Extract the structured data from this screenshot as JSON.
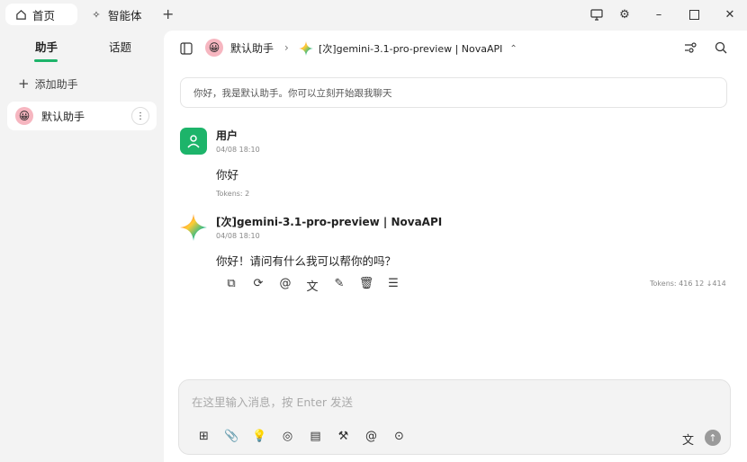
{
  "tabs": [
    {
      "label": "首页",
      "icon": "home-icon"
    },
    {
      "label": "智能体",
      "icon": "sparkle-icon"
    }
  ],
  "sidebar": {
    "tabs": [
      "助手",
      "话题"
    ],
    "add_label": "添加助手",
    "items": [
      {
        "label": "默认助手",
        "avatar": "😀"
      }
    ]
  },
  "header": {
    "assistant": "默认助手",
    "model": "[次]gemini-3.1-pro-preview | NovaAPI"
  },
  "notice": "你好，我是默认助手。你可以立刻开始跟我聊天",
  "messages": [
    {
      "name": "用户",
      "time": "04/08 18:10",
      "content": "你好",
      "tokens": "Tokens: 2"
    },
    {
      "name": "[次]gemini-3.1-pro-preview | NovaAPI",
      "time": "04/08 18:10",
      "content": "你好！请问有什么我可以帮你的吗？",
      "tokens": "Tokens: 416 12 ↓414"
    }
  ],
  "input": {
    "placeholder": "在这里输入消息，按 Enter 发送"
  },
  "colors": {
    "accent": "#1db46a",
    "user_avatar": "#1db46a"
  }
}
